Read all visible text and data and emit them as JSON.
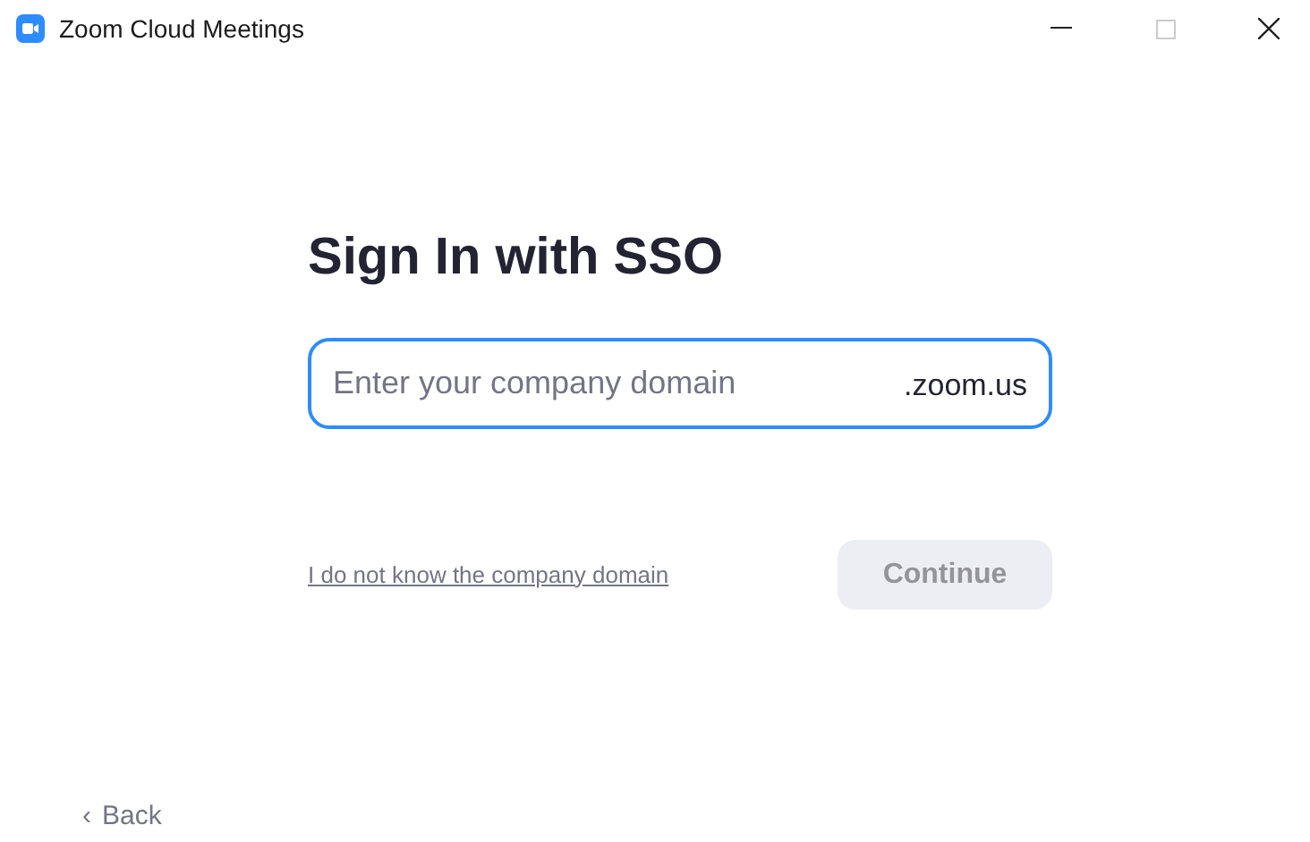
{
  "window": {
    "title": "Zoom Cloud Meetings"
  },
  "heading": "Sign In with SSO",
  "domain_field": {
    "placeholder": "Enter your company domain",
    "suffix": ".zoom.us"
  },
  "help_link": "I do not know the company domain",
  "continue_button": {
    "label": "Continue",
    "disabled": true
  },
  "back_link": {
    "arrow": "‹",
    "label": "Back"
  }
}
